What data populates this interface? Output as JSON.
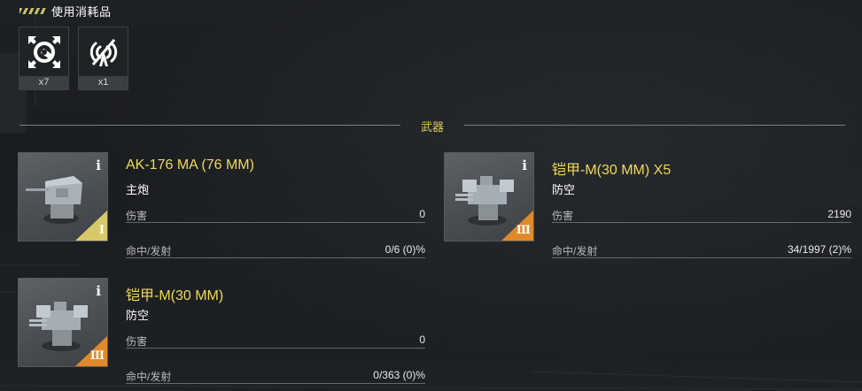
{
  "consumables": {
    "title": "使用消耗品",
    "items": [
      {
        "icon": "repair-kit-icon",
        "count": "x7"
      },
      {
        "icon": "jammer-icon",
        "count": "x1"
      }
    ]
  },
  "weapons_section": {
    "title": "武器",
    "weapons": [
      {
        "name": "AK-176 MA (76 MM)",
        "type": "主炮",
        "damage_label": "伤害",
        "damage": "0",
        "hits_label": "命中/发射",
        "hits": "0/6 (0)%",
        "tier": "I",
        "tier_color": "#d7c96a"
      },
      {
        "name": "铠甲-M(30 MM) X5",
        "type": "防空",
        "damage_label": "伤害",
        "damage": "2190",
        "hits_label": "命中/发射",
        "hits": "34/1997 (2)%",
        "tier": "III",
        "tier_color": "#e0892a"
      },
      {
        "name": "铠甲-M(30 MM)",
        "type": "防空",
        "damage_label": "伤害",
        "damage": "0",
        "hits_label": "命中/发射",
        "hits": "0/363 (0)%",
        "tier": "III",
        "tier_color": "#e0892a"
      }
    ]
  },
  "colors": {
    "accent_yellow": "#f0d957",
    "section_title": "#d8c95c",
    "tier_one": "#d7c96a",
    "tier_three": "#e0892a"
  }
}
